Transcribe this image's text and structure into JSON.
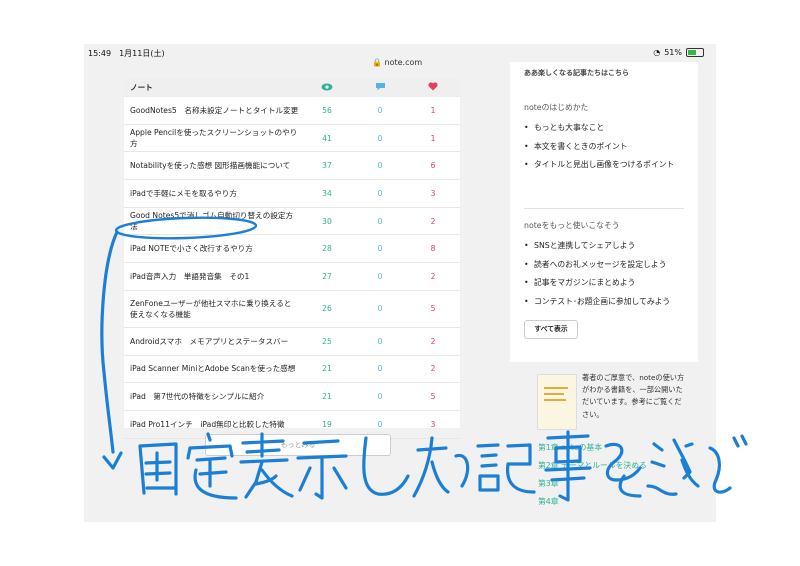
{
  "status": {
    "time": "15:49",
    "date": "1月11日(土)",
    "url": "note.com",
    "battery": "51%"
  },
  "table": {
    "header": "ノート",
    "rows": [
      {
        "title": "GoodNotes5　名称未設定ノートとタイトル変更",
        "views": "56",
        "comments": "0",
        "likes": "1"
      },
      {
        "title": "Apple Pencilを使ったスクリーンショットのやり方",
        "views": "41",
        "comments": "0",
        "likes": "1"
      },
      {
        "title": "Notabilityを使った感想 図形描画機能について",
        "views": "37",
        "comments": "0",
        "likes": "6"
      },
      {
        "title": "iPadで手軽にメモを取るやり方",
        "views": "34",
        "comments": "0",
        "likes": "3"
      },
      {
        "title": "Good Notes5で消しゴム自動切り替えの設定方法",
        "views": "30",
        "comments": "0",
        "likes": "2"
      },
      {
        "title": "iPad NOTEで小さく改行するやり方",
        "views": "28",
        "comments": "0",
        "likes": "8"
      },
      {
        "title": "iPad音声入力　単語発音集　その1",
        "views": "27",
        "comments": "0",
        "likes": "2"
      },
      {
        "title": "ZenFoneユーザーが他社スマホに乗り換えると使えなくなる機能",
        "views": "26",
        "comments": "0",
        "likes": "5"
      },
      {
        "title": "Androidスマホ　メモアプリとステータスバー",
        "views": "25",
        "comments": "0",
        "likes": "2"
      },
      {
        "title": "iPad Scanner MiniとAdobe Scanを使った感想",
        "views": "21",
        "comments": "0",
        "likes": "2"
      },
      {
        "title": "iPad　第7世代の特徴をシンプルに紹介",
        "views": "21",
        "comments": "0",
        "likes": "5"
      },
      {
        "title": "iPad Pro11インチ　iPad無印と比較した特徴",
        "views": "19",
        "comments": "0",
        "likes": "3"
      }
    ],
    "more_label": "もっとみる"
  },
  "sidebar": {
    "cut_title": "ああ楽しくなる記事たちはこちら",
    "section1": {
      "title": "noteのはじめかた",
      "items": [
        "もっとも大事なこと",
        "本文を書くときのポイント",
        "タイトルと見出し画像をつけるポイント"
      ]
    },
    "section2": {
      "title": "noteをもっと使いこなそう",
      "items": [
        "SNSと連携してシェアしよう",
        "読者へのお礼メッセージを設定しよう",
        "記事をマガジンにまとめよう",
        "コンテスト･お題企画に参加してみよう"
      ]
    },
    "show_all": "すべて表示",
    "book_desc": "著者のご厚意で、noteの使い方がわかる書籍を、一部公開いただいています。参考にご覧ください。",
    "chapters": [
      "第1章 noteの基本",
      "第2章 テーマとルールを決める",
      "第3章",
      "第4章"
    ]
  },
  "annotation": {
    "handwritten": "固定表示したい記事を選ぶ"
  },
  "colors": {
    "views": "#2bb596",
    "comments": "#58b3e0",
    "likes": "#e2405b",
    "ink": "#1c7fd6"
  }
}
